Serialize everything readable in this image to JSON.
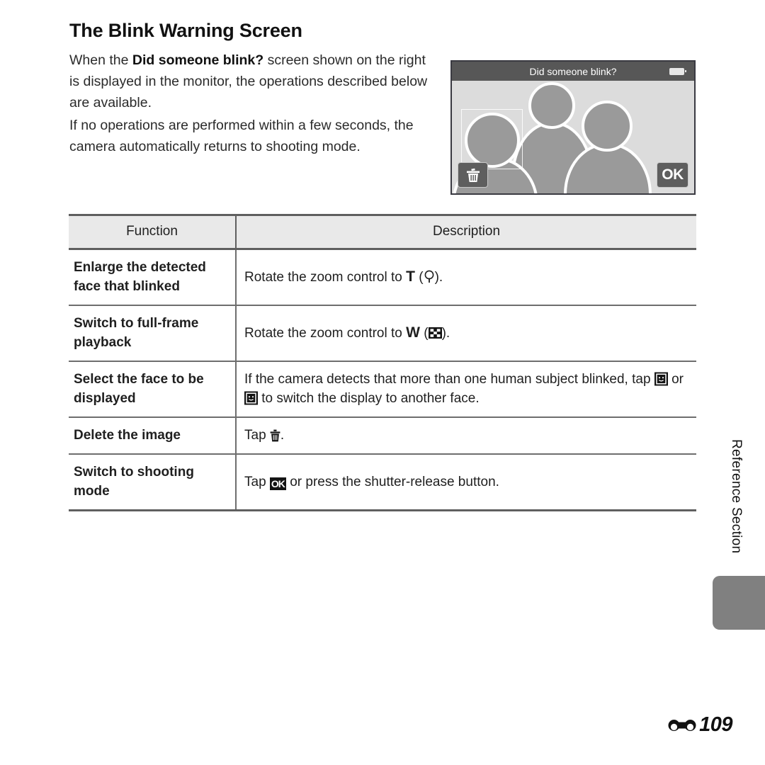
{
  "page": {
    "title": "The Blink Warning Screen",
    "intro_paragraphs": [
      "When the Did someone blink? screen shown on the right is displayed in the monitor, the operations described below are available.",
      "If no operations are performed within a few seconds, the camera automatically returns to shooting mode."
    ],
    "intro_1_before": "When the ",
    "intro_1_bold": "Did someone blink?",
    "intro_1_after": " screen shown on the right is displayed in the monitor, the operations described below are available.",
    "intro_2": "If no operations are performed within a few seconds, the camera automatically returns to shooting mode.",
    "side_label": "Reference Section",
    "footer_mark": "reference-section-mark",
    "footer_page": "109"
  },
  "monitor": {
    "title": "Did someone blink?",
    "battery_icon": "battery-full-icon",
    "delete_button_icon": "trash-icon",
    "ok_button_label": "OK",
    "face_box": "face-selection-box",
    "figures": [
      "back-figure",
      "left-figure-selected",
      "right-figure"
    ]
  },
  "table": {
    "headers": [
      "Function",
      "Description"
    ],
    "rows": [
      {
        "function": "Enlarge the detected face that blinked",
        "desc_parts": {
          "before": "Rotate the zoom control to ",
          "key": "T",
          "mid": " (",
          "icon": "magnifier-icon",
          "after": ")."
        }
      },
      {
        "function": "Switch to full-frame playback",
        "desc_parts": {
          "before": "Rotate the zoom control to ",
          "key": "W",
          "mid": " (",
          "icon": "thumbnail-view-icon",
          "after": ")."
        }
      },
      {
        "function": "Select the face to be displayed",
        "desc_parts": {
          "before": "If the camera detects that more than one human subject blinked, tap ",
          "icon": "face-select-previous-icon",
          "mid": " or ",
          "icon2": "face-select-next-icon",
          "after": " to switch the display to another face."
        }
      },
      {
        "function": "Delete the image",
        "desc_parts": {
          "before": "Tap ",
          "icon": "trash-icon",
          "after": "."
        }
      },
      {
        "function": "Switch to shooting mode",
        "desc_parts": {
          "before": "Tap ",
          "icon": "ok-button-icon",
          "icon_label": "OK",
          "after": " or press the shutter-release button."
        }
      }
    ]
  },
  "colors": {
    "page_background": "#ffffff",
    "text": "#1f1f1f",
    "table_header_background": "#e9e9e9",
    "table_border": "#5f5f5f",
    "monitor_titlebar": "#575757",
    "monitor_scene": "#dcdcdc",
    "figure_fill": "#9a9a9a",
    "side_tab": "#808080"
  }
}
